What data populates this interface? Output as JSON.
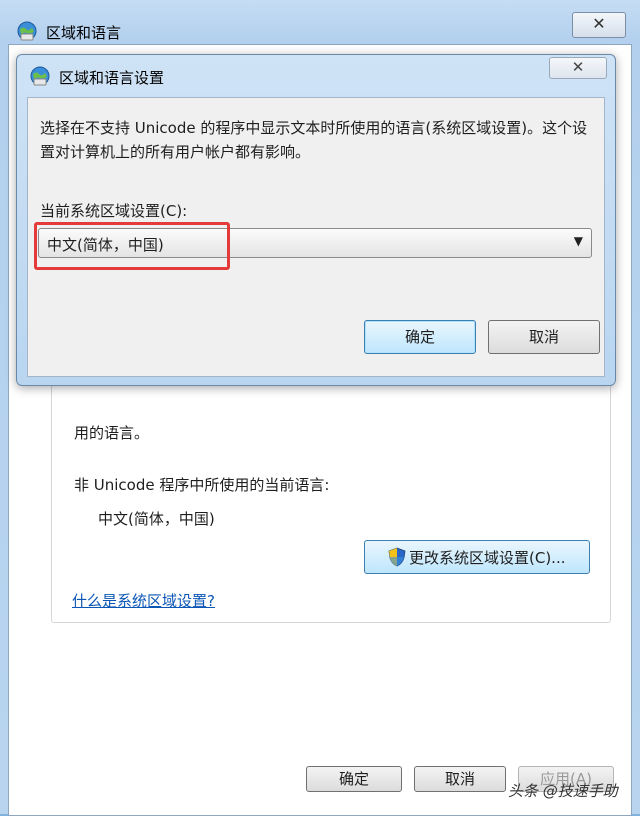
{
  "outer_window": {
    "title": "区域和语言",
    "close_label": "✕",
    "group": {
      "partial_text": "用的语言。",
      "current_language_label": "非 Unicode 程序中所使用的当前语言:",
      "current_language_value": "中文(简体，中国)",
      "change_button_label": "更改系统区域设置(C)...",
      "help_link": "什么是系统区域设置?"
    },
    "buttons": {
      "ok": "确定",
      "cancel": "取消",
      "apply": "应用(A)"
    }
  },
  "dialog": {
    "title": "区域和语言设置",
    "close_label": "✕",
    "description": "选择在不支持 Unicode 的程序中显示文本时所使用的语言(系统区域设置)。这个设置对计算机上的所有用户帐户都有影响。",
    "locale_label": "当前系统区域设置(C):",
    "locale_value": "中文(简体，中国)",
    "ok_button": "确定",
    "cancel_button": "取消"
  },
  "watermark": "头条 @技速手助",
  "colors": {
    "highlight": "#e53a3a",
    "link": "#0b56b5",
    "window_frame": "#b8d4ef"
  }
}
